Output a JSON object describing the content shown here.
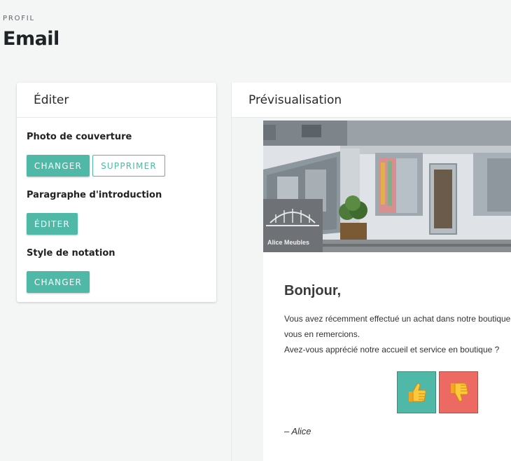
{
  "page": {
    "kicker": "PROFIL",
    "title": "Email"
  },
  "editor": {
    "header": "Éditer",
    "cover": {
      "label": "Photo de couverture",
      "change": "CHANGER",
      "remove": "SUPPRIMER"
    },
    "intro": {
      "label": "Paragraphe d'introduction",
      "edit": "ÉDITER"
    },
    "rating": {
      "label": "Style de notation",
      "change": "CHANGER"
    }
  },
  "preview": {
    "header": "Prévisualisation",
    "store_sign": "Alice Meubles",
    "greeting": "Bonjour,",
    "lines": [
      "Vous avez récemment effectué un achat dans notre boutique",
      "vous en remercions.",
      "Avez-vous apprécié notre accueil et service en boutique ?"
    ],
    "signature": "– Alice",
    "rating_buttons": [
      {
        "icon": "thumbs-up-icon",
        "color": "#4fb8a6"
      },
      {
        "icon": "thumbs-down-icon",
        "color": "#ec6a62"
      }
    ]
  },
  "colors": {
    "accent": "#4fb8a6",
    "negative": "#ec6a62",
    "background": "#f4f6f6"
  }
}
